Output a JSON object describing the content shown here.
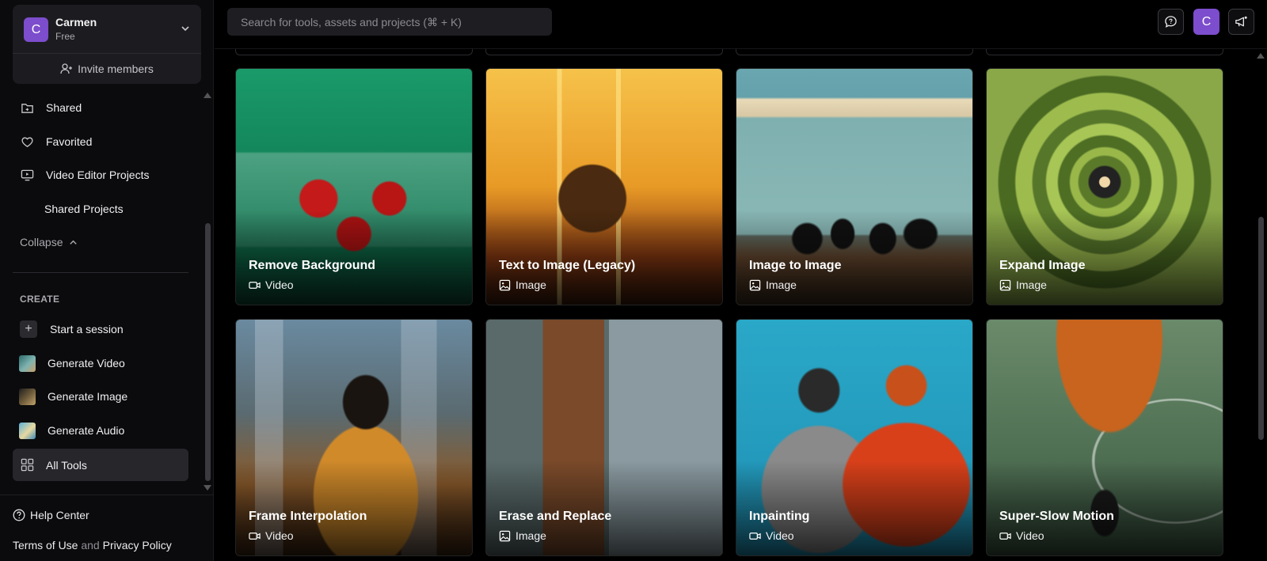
{
  "account": {
    "initial": "C",
    "name": "Carmen",
    "plan": "Free",
    "invite_label": "Invite members"
  },
  "sidebar": {
    "nav": [
      {
        "label": "Shared",
        "icon": "shared-folder-icon"
      },
      {
        "label": "Favorited",
        "icon": "heart-icon"
      },
      {
        "label": "Video Editor Projects",
        "icon": "monitor-play-icon"
      },
      {
        "label": "Shared Projects",
        "icon": ""
      }
    ],
    "collapse_label": "Collapse",
    "create_section": "CREATE",
    "create_items": [
      {
        "label": "Start a session",
        "icon": "plus-icon"
      },
      {
        "label": "Generate Video",
        "icon": "video-thumb"
      },
      {
        "label": "Generate Image",
        "icon": "image-thumb"
      },
      {
        "label": "Generate Audio",
        "icon": "audio-thumb"
      },
      {
        "label": "All Tools",
        "icon": "grid-icon",
        "active": true
      }
    ],
    "help_label": "Help Center",
    "legal": {
      "terms": "Terms of Use",
      "and": "and",
      "privacy": "Privacy Policy"
    }
  },
  "topbar": {
    "search_placeholder": "Search for tools, assets and projects (⌘ + K)",
    "avatar_initial": "C"
  },
  "tools": [
    {
      "title": "Remove Background",
      "type": "Video"
    },
    {
      "title": "Text to Image (Legacy)",
      "type": "Image"
    },
    {
      "title": "Image to Image",
      "type": "Image"
    },
    {
      "title": "Expand Image",
      "type": "Image"
    },
    {
      "title": "Frame Interpolation",
      "type": "Video"
    },
    {
      "title": "Erase and Replace",
      "type": "Image"
    },
    {
      "title": "Inpainting",
      "type": "Video"
    },
    {
      "title": "Super-Slow Motion",
      "type": "Video"
    }
  ],
  "colors": {
    "accent": "#7c4dcc",
    "background": "#000000",
    "sidebar": "#0b0b0d"
  }
}
